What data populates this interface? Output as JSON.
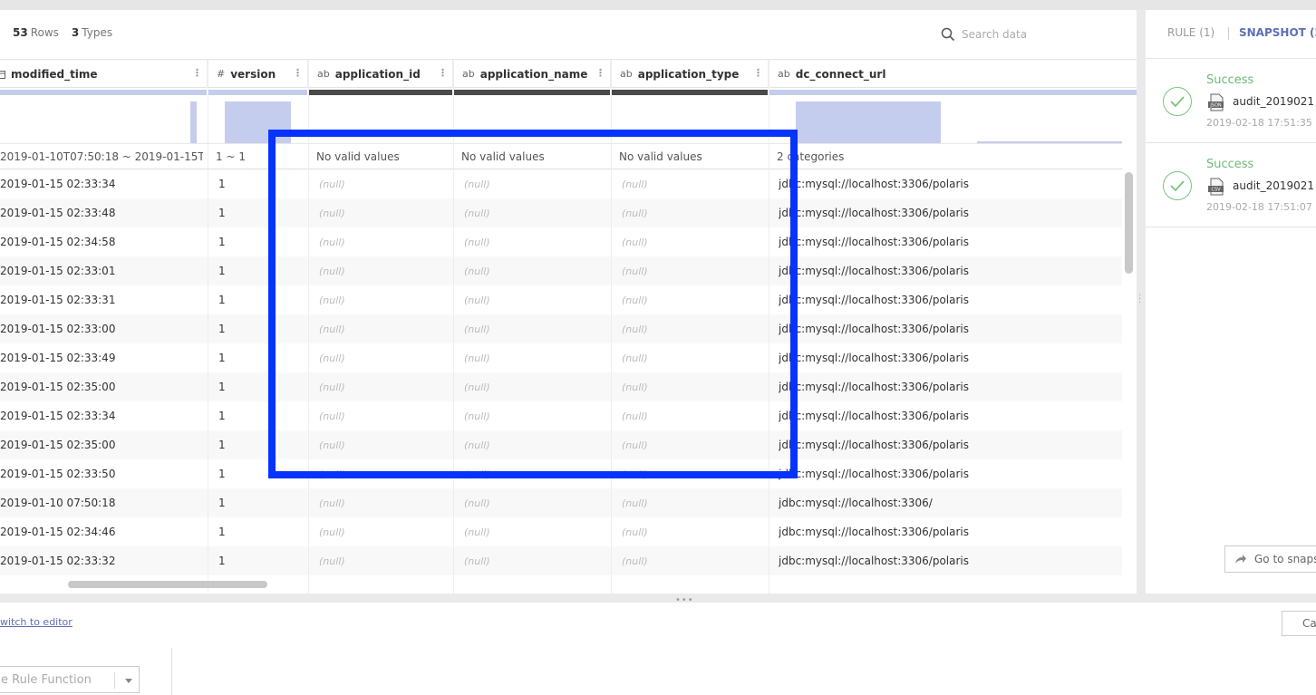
{
  "toolbar": {
    "rows_count": "53",
    "rows_label": "Rows",
    "types_count": "3",
    "types_label": "Types",
    "search_placeholder": "Search data"
  },
  "columns": [
    {
      "type_icon": "calendar-icon",
      "type_glyph": "",
      "name": "modified_time",
      "stat": "2019-01-10T07:50:18 ~ 2019-01-15T…"
    },
    {
      "type_icon": "number-icon",
      "type_glyph": "#",
      "name": "version",
      "stat": "1 ~ 1"
    },
    {
      "type_icon": "string-icon",
      "type_glyph": "ab",
      "name": "application_id",
      "stat": "No valid values"
    },
    {
      "type_icon": "string-icon",
      "type_glyph": "ab",
      "name": "application_name",
      "stat": "No valid values"
    },
    {
      "type_icon": "string-icon",
      "type_glyph": "ab",
      "name": "application_type",
      "stat": "No valid values"
    },
    {
      "type_icon": "string-icon",
      "type_glyph": "ab",
      "name": "dc_connect_url",
      "stat": "2 categories"
    }
  ],
  "rows": [
    [
      "2019-01-15 02:33:34",
      "1",
      "(null)",
      "(null)",
      "(null)",
      "jdbc:mysql://localhost:3306/polaris"
    ],
    [
      "2019-01-15 02:33:48",
      "1",
      "(null)",
      "(null)",
      "(null)",
      "jdbc:mysql://localhost:3306/polaris"
    ],
    [
      "2019-01-15 02:34:58",
      "1",
      "(null)",
      "(null)",
      "(null)",
      "jdbc:mysql://localhost:3306/polaris"
    ],
    [
      "2019-01-15 02:33:01",
      "1",
      "(null)",
      "(null)",
      "(null)",
      "jdbc:mysql://localhost:3306/polaris"
    ],
    [
      "2019-01-15 02:33:31",
      "1",
      "(null)",
      "(null)",
      "(null)",
      "jdbc:mysql://localhost:3306/polaris"
    ],
    [
      "2019-01-15 02:33:00",
      "1",
      "(null)",
      "(null)",
      "(null)",
      "jdbc:mysql://localhost:3306/polaris"
    ],
    [
      "2019-01-15 02:33:49",
      "1",
      "(null)",
      "(null)",
      "(null)",
      "jdbc:mysql://localhost:3306/polaris"
    ],
    [
      "2019-01-15 02:35:00",
      "1",
      "(null)",
      "(null)",
      "(null)",
      "jdbc:mysql://localhost:3306/polaris"
    ],
    [
      "2019-01-15 02:33:34",
      "1",
      "(null)",
      "(null)",
      "(null)",
      "jdbc:mysql://localhost:3306/polaris"
    ],
    [
      "2019-01-15 02:35:00",
      "1",
      "(null)",
      "(null)",
      "(null)",
      "jdbc:mysql://localhost:3306/polaris"
    ],
    [
      "2019-01-15 02:33:50",
      "1",
      "(null)",
      "(null)",
      "(null)",
      "jdbc:mysql://localhost:3306/polaris"
    ],
    [
      "2019-01-10 07:50:18",
      "1",
      "(null)",
      "(null)",
      "(null)",
      "jdbc:mysql://localhost:3306/"
    ],
    [
      "2019-01-15 02:34:46",
      "1",
      "(null)",
      "(null)",
      "(null)",
      "jdbc:mysql://localhost:3306/polaris"
    ],
    [
      "2019-01-15 02:33:32",
      "1",
      "(null)",
      "(null)",
      "(null)",
      "jdbc:mysql://localhost:3306/polaris"
    ]
  ],
  "right_panel": {
    "tab_rule": "RULE (1)",
    "tab_snapshot": "SNAPSHOT (2",
    "snapshots": [
      {
        "status": "Success",
        "file_icon": "json-file-icon",
        "file_label": "JSON",
        "name": "audit_2019021",
        "time": "2019-02-18 17:51:35"
      },
      {
        "status": "Success",
        "file_icon": "csv-file-icon",
        "file_label": "CSV",
        "name": "audit_2019021",
        "time": "2019-02-18 17:51:07"
      }
    ],
    "goto_label": "Go to snaps"
  },
  "bottom": {
    "switch_link": "witch to editor",
    "rule_function_placeholder": "e Rule Function",
    "cancel_label": "Ca"
  },
  "colors": {
    "accent": "#5d6fb5",
    "highlight": "#0733ff",
    "success": "#6dbb74",
    "hist_fill": "#c5cdee",
    "bar_dark": "#4a4a4a"
  }
}
